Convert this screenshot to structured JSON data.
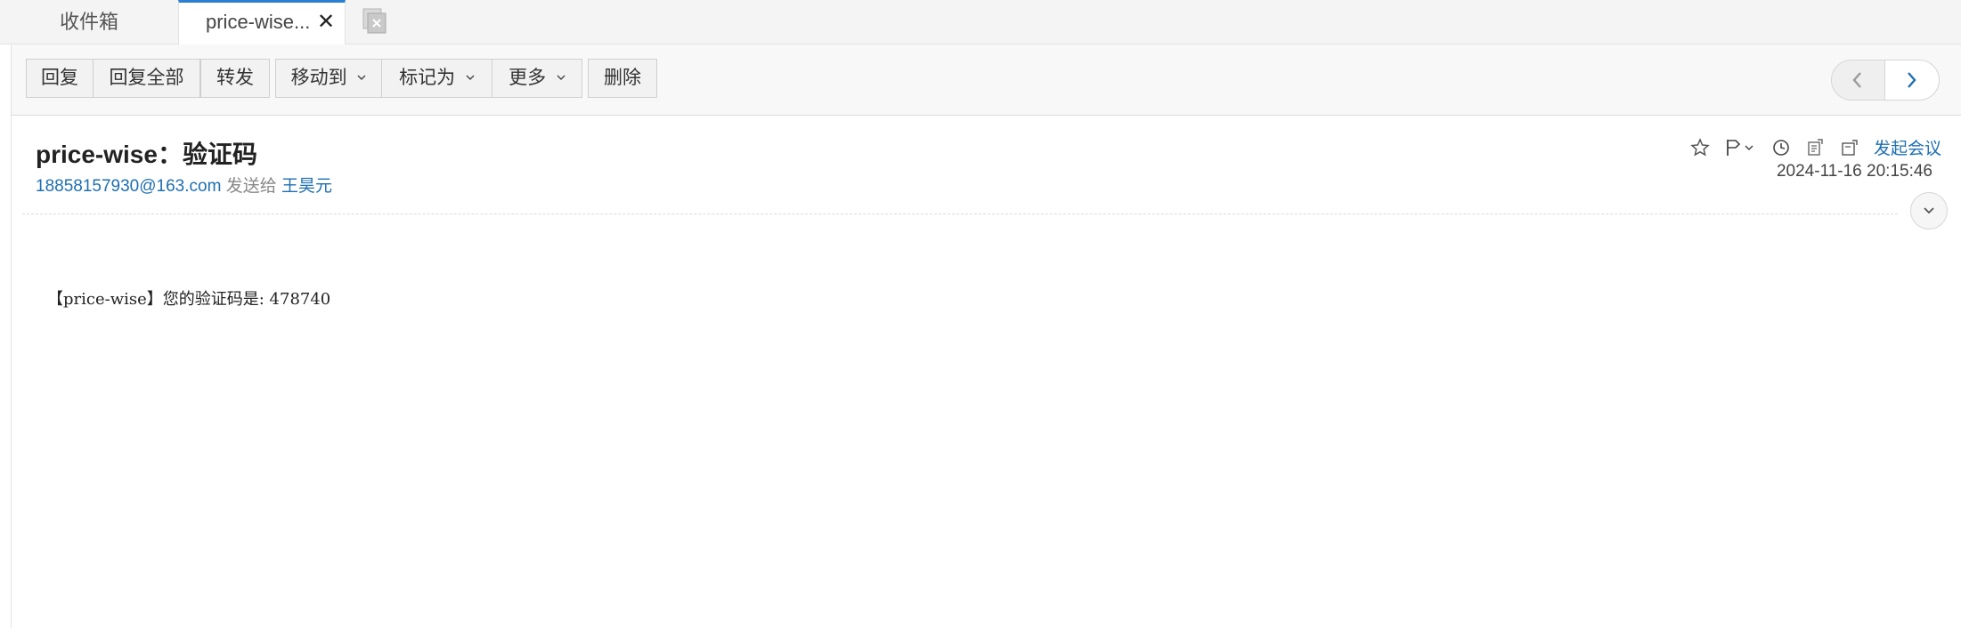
{
  "tabs": {
    "inbox_label": "收件箱",
    "active_label": "price-wise...",
    "close_glyph": "✕"
  },
  "toolbar": {
    "reply": "回复",
    "reply_all": "回复全部",
    "forward": "转发",
    "move_to": "移动到",
    "mark_as": "标记为",
    "more": "更多",
    "delete": "删除"
  },
  "mail": {
    "subject": "price-wise：验证码",
    "sender": "18858157930@163.com",
    "sent_to_label": "发送给",
    "recipient": "王昊元",
    "datetime": "2024-11-16 20:15:46",
    "start_meeting": "发起会议",
    "body": "【price-wise】您的验证码是: 478740"
  },
  "icons": {
    "header": [
      "star-icon",
      "flag-icon",
      "clock-icon",
      "export-icon",
      "note-icon"
    ],
    "pager": [
      "chevron-left-icon",
      "chevron-right-icon"
    ]
  },
  "colors": {
    "accent": "#1f6fb2",
    "tab_active_border": "#2a7fd1"
  }
}
